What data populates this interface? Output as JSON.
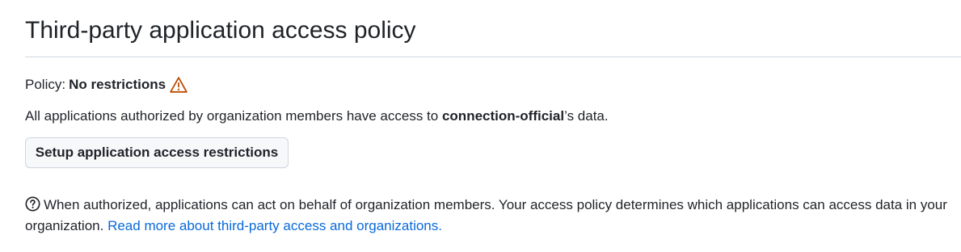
{
  "section": {
    "title": "Third-party application access policy"
  },
  "policy": {
    "label": "Policy:",
    "value": "No restrictions",
    "status_icon": "alert-icon",
    "status_color": "#bc4c00"
  },
  "description": {
    "prefix": "All applications authorized by organization members have access to",
    "organization": "connection-official",
    "suffix": "’s data."
  },
  "actions": {
    "setup_label": "Setup application access restrictions"
  },
  "help": {
    "icon": "question-icon",
    "text": "When authorized, applications can act on behalf of organization members. Your access policy determines which applications can access data in your organization.",
    "link_text": "Read more about third-party access and organizations.",
    "link_color": "#0969da"
  }
}
